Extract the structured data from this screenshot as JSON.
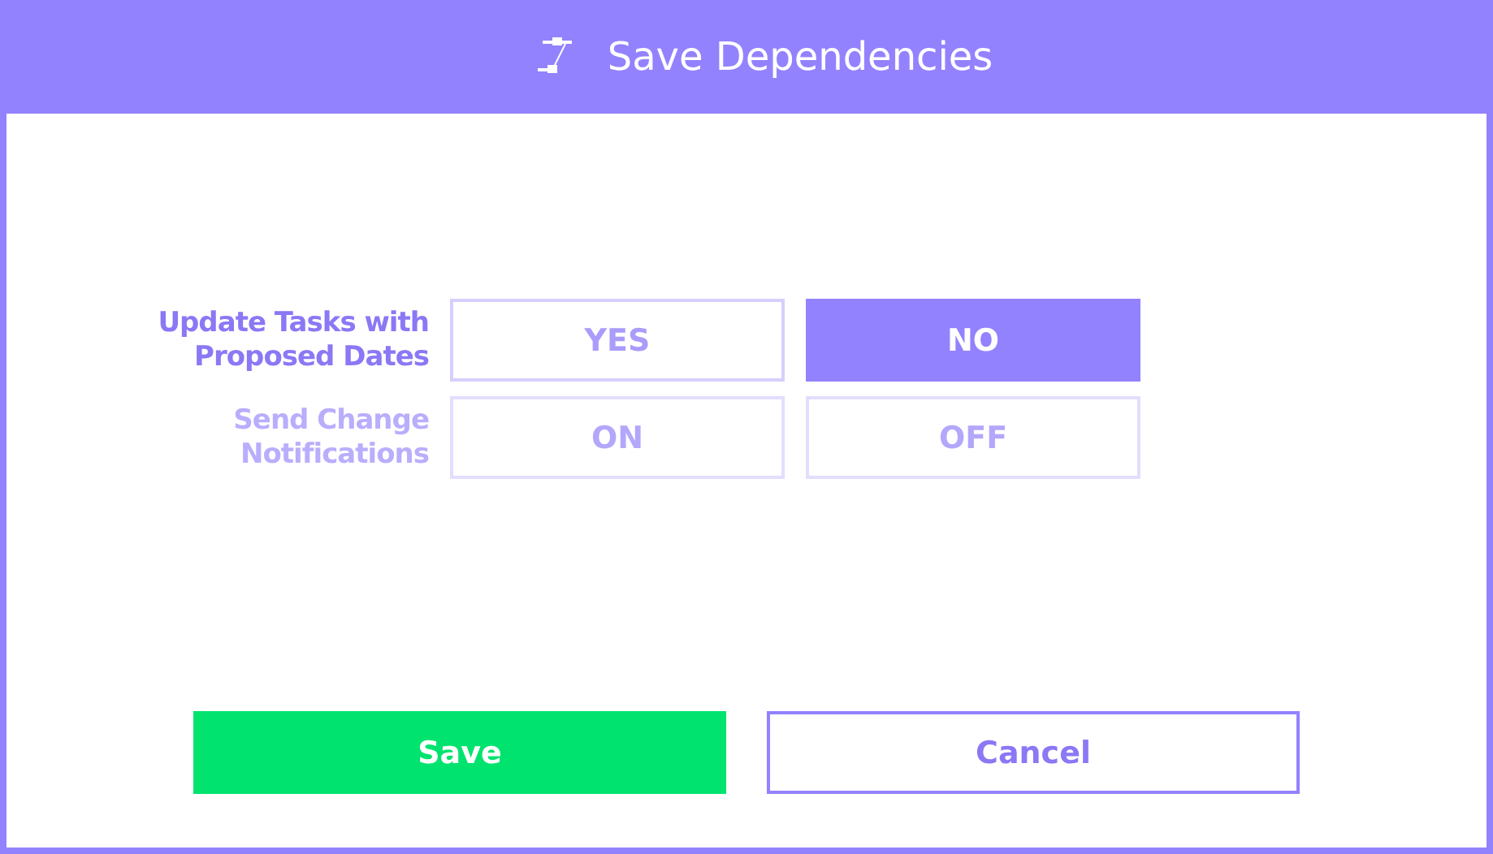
{
  "window": {
    "title": "Save Dependencies"
  },
  "settings": [
    {
      "label": "Update Tasks with Proposed Dates",
      "disabled": false,
      "options": [
        {
          "label": "YES",
          "selected": false
        },
        {
          "label": "NO",
          "selected": true
        }
      ]
    },
    {
      "label": "Send Change Notifications",
      "disabled": true,
      "options": [
        {
          "label": "ON",
          "selected": false
        },
        {
          "label": "OFF",
          "selected": false
        }
      ]
    }
  ],
  "buttons": [
    {
      "label": "Save",
      "kind": "primary"
    },
    {
      "label": "Cancel",
      "kind": "secondary"
    }
  ]
}
